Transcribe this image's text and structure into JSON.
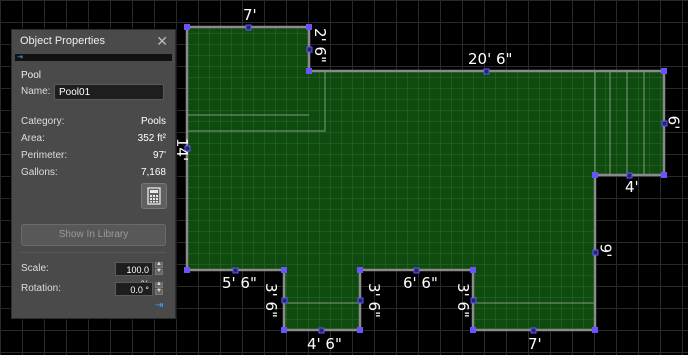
{
  "panel": {
    "title": "Object Properties",
    "close_glyph": "✕",
    "pin_glyph": "⇥",
    "object_type": "Pool",
    "name_label": "Name:",
    "name_value": "Pool01",
    "props": [
      {
        "label": "Category:",
        "value": "Pools"
      },
      {
        "label": "Area:",
        "value": "352 ft²"
      },
      {
        "label": "Perimeter:",
        "value": "97'"
      },
      {
        "label": "Gallons:",
        "value": "7,168"
      }
    ],
    "calculator_icon": "calculator-icon",
    "show_in_library": "Show In Library",
    "scale_label": "Scale:",
    "scale_value": "100.0 %",
    "rotation_label": "Rotation:",
    "rotation_value": "0.0 °",
    "spin_up": "▲",
    "spin_down": "▼",
    "bottom_pin_glyph": "⇥"
  },
  "dimensions": {
    "top_left": "7'",
    "notch_vertical": "2' 6\"",
    "top_right": "20' 6\"",
    "right_side": "6'",
    "left_side": "14'",
    "step_horizontal": "4'",
    "right_lower": "9'",
    "bottom_left_horizontal": "5' 6\"",
    "left_notch_vertical": "3' 6\"",
    "left_notch_bottom": "4' 6\"",
    "middle_notch_vertical": "3' 6\"",
    "middle_top": "6' 6\"",
    "right_notch_vertical": "3' 6\"",
    "bottom_right": "7'"
  },
  "colors": {
    "canvas_bg": "#000000",
    "grid": "#2a2a2a",
    "pool_fill": "#0f4a0f",
    "pool_outline": "#8a8a8a",
    "handle": "#6a52ff",
    "panel_bg": "#4a4a4a",
    "accent": "#38a1ff"
  }
}
